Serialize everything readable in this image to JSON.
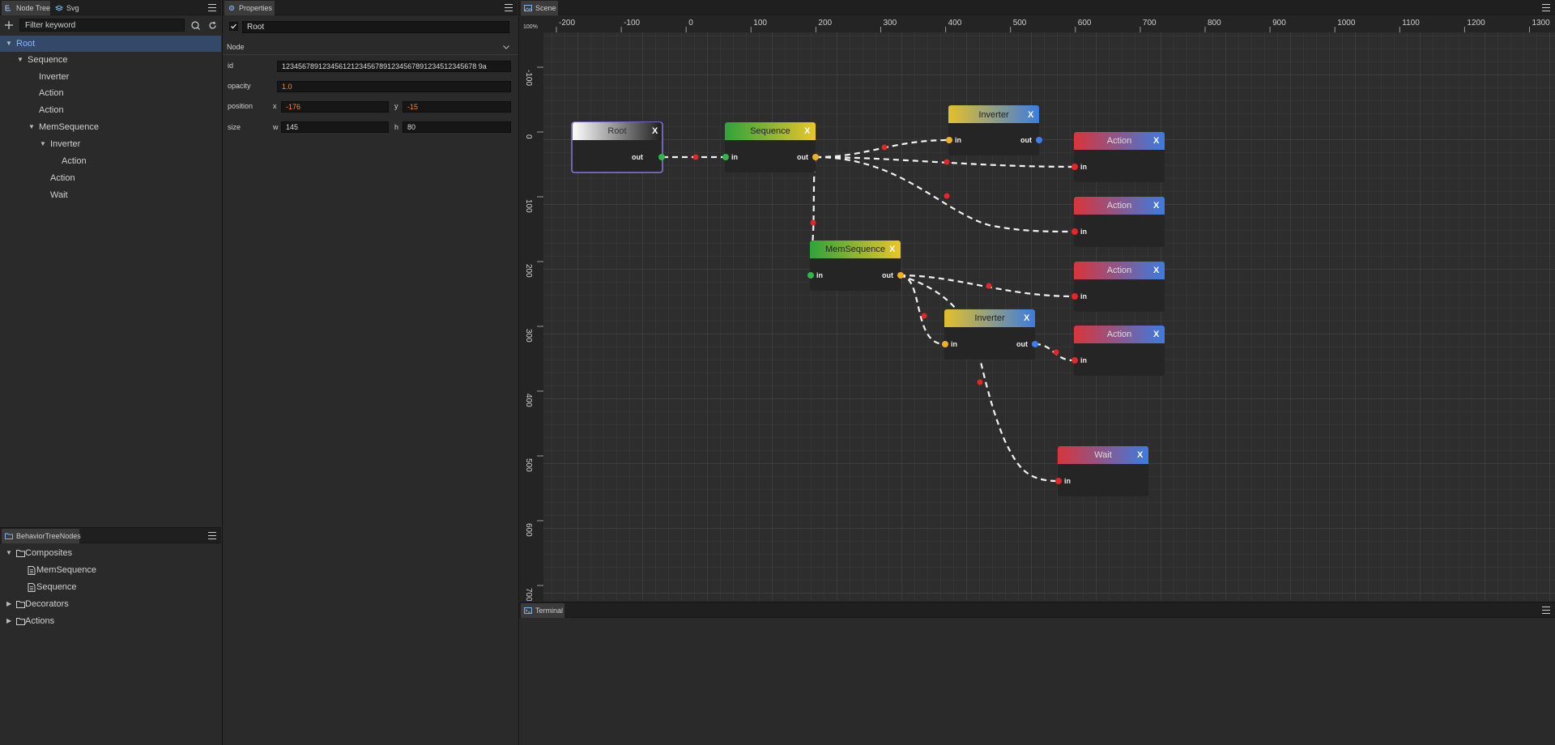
{
  "node_tree_panel": {
    "tabs": [
      {
        "label": "Node Tree"
      },
      {
        "label": "Svg"
      }
    ],
    "filter_placeholder": "Filter keyword",
    "items": [
      {
        "label": "Root"
      },
      {
        "label": "Sequence"
      },
      {
        "label": "Inverter"
      },
      {
        "label": "Action"
      },
      {
        "label": "Action"
      },
      {
        "label": "MemSequence"
      },
      {
        "label": "Inverter"
      },
      {
        "label": "Action"
      },
      {
        "label": "Action"
      },
      {
        "label": "Wait"
      }
    ]
  },
  "palette_panel": {
    "tab_label": "BehaviorTreeNodes",
    "items": [
      {
        "label": "Composites"
      },
      {
        "label": "MemSequence"
      },
      {
        "label": "Sequence"
      },
      {
        "label": "Decorators"
      },
      {
        "label": "Actions"
      }
    ]
  },
  "properties_panel": {
    "tab_label": "Properties",
    "name_value": "Root",
    "section_label": "Node",
    "fields": {
      "id": {
        "label": "id",
        "value": "123456789123456121234567891234567891234512345678 9a"
      },
      "opacity": {
        "label": "opacity",
        "value": "1.0"
      },
      "position": {
        "label": "position",
        "x_label": "x",
        "x_value": "-176",
        "y_label": "y",
        "y_value": "-15"
      },
      "size": {
        "label": "size",
        "w_label": "w",
        "w_value": "145",
        "h_label": "h",
        "h_value": "80"
      }
    }
  },
  "scene_panel": {
    "tab_label": "Scene",
    "zoom_label": "100%",
    "x_ticks": [
      "-200",
      "-100",
      "0",
      "100",
      "200",
      "300",
      "400",
      "500",
      "600",
      "700",
      "800",
      "900",
      "1000",
      "1100",
      "1200",
      "1300"
    ],
    "y_ticks": [
      "-100",
      "0",
      "100",
      "200",
      "300",
      "400",
      "500",
      "600",
      "700"
    ],
    "port_labels": {
      "in": "in",
      "out": "out"
    },
    "close_glyph": "X",
    "nodes": [
      {
        "title": "Root"
      },
      {
        "title": "Sequence"
      },
      {
        "title": "Inverter"
      },
      {
        "title": "Action"
      },
      {
        "title": "Action"
      },
      {
        "title": "MemSequence"
      },
      {
        "title": "Action"
      },
      {
        "title": "Inverter"
      },
      {
        "title": "Action"
      },
      {
        "title": "Wait"
      }
    ]
  },
  "terminal_panel": {
    "tab_label": "Terminal"
  },
  "colors": {
    "background": "#2a2a2a",
    "selection": "#34496a",
    "composite_green": "#2fa33a",
    "decorator_yellow": "#e3c02a",
    "action_red": "#d8353a",
    "accent_blue": "#3c7ce0",
    "port_green": "#2fb84a",
    "port_yellow": "#f0b020",
    "port_red": "#e02828",
    "port_blue": "#3a7ef0",
    "selected_border": "#8a78e6"
  }
}
